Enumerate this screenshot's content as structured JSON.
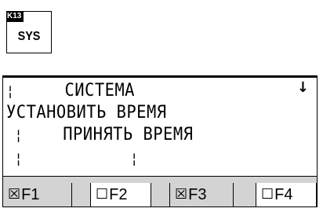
{
  "key": {
    "number": "K13",
    "label": "SYS"
  },
  "screen": {
    "lines": [
      {
        "prefix": "¦",
        "text": "     СИСТЕМА"
      },
      {
        "prefix": "",
        "text": "УСТАНОВИТЬ ВРЕМЯ"
      },
      {
        "prefix": " ¦",
        "text": "    ПРИНЯТЬ ВРЕМЯ"
      },
      {
        "prefix": " ¦",
        "text": "             ¦"
      }
    ],
    "scroll_arrow": "↓"
  },
  "softkeys": [
    {
      "check": "☒",
      "label": "F1",
      "selected": true
    },
    {
      "check": "☐",
      "label": "F2",
      "selected": false
    },
    {
      "check": "☒",
      "label": "F3",
      "selected": true
    },
    {
      "check": "☐",
      "label": "F4",
      "selected": false
    }
  ],
  "colors": {
    "background": "#ffffff",
    "softkey_bar": "#d3d3d3",
    "text": "#000000"
  }
}
